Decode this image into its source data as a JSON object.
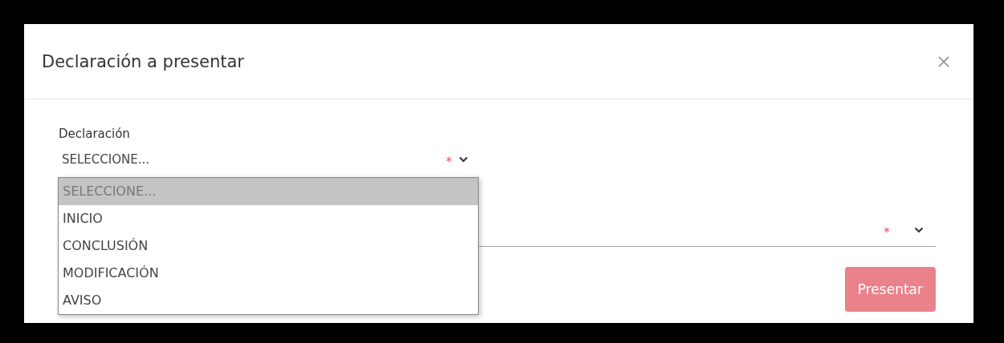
{
  "modal": {
    "title": "Declaración a presentar"
  },
  "fields": [
    {
      "label": "Declaración",
      "value": "SELECCIONE...",
      "required": true,
      "open": true,
      "options": [
        {
          "label": "SELECCIONE...",
          "selected": true
        },
        {
          "label": "INICIO",
          "selected": false
        },
        {
          "label": "CONCLUSIÓN",
          "selected": false
        },
        {
          "label": "MODIFICACIÓN",
          "selected": false
        },
        {
          "label": "AVISO",
          "selected": false
        }
      ]
    },
    {
      "required": true,
      "open": false
    }
  ],
  "submit": {
    "label": "Presentar",
    "disabled": true
  }
}
